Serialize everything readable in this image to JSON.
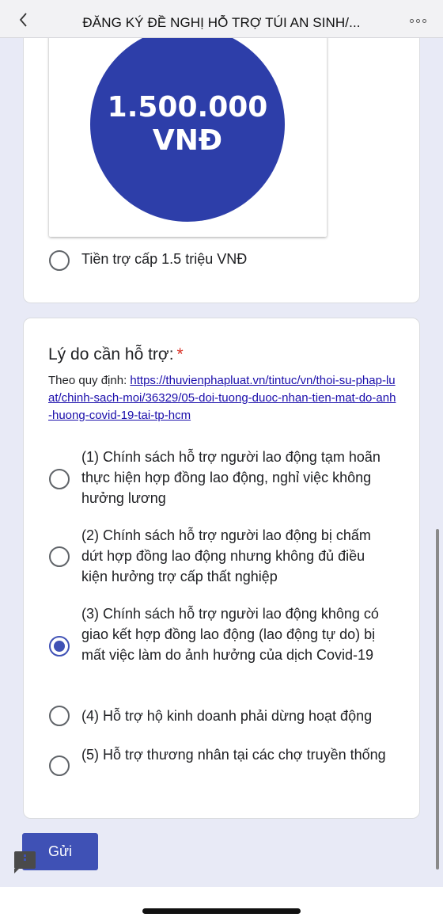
{
  "header": {
    "title": "ĐĂNG KÝ ĐỀ NGHỊ HỖ TRỢ TÚI AN SINH/...",
    "back_icon": "chevron-left-icon",
    "more_icon": "more-horizontal-icon"
  },
  "image_card": {
    "coin_amount": "1.500.000",
    "coin_currency": "VNĐ",
    "option_label": "Tiền trợ cấp 1.5 triệu VNĐ",
    "option_selected": false
  },
  "question": {
    "title": "Lý do cần hỗ trợ:",
    "required_mark": "*",
    "description_prefix": "Theo quy định: ",
    "description_link": "https://thuvienphapluat.vn/tintuc/vn/thoi-su-phap-luat/chinh-sach-moi/36329/05-doi-tuong-duoc-nhan-tien-mat-do-anh-huong-covid-19-tai-tp-hcm",
    "options": [
      {
        "label": "(1) Chính sách hỗ trợ người lao động tạm hoãn thực hiện hợp đồng lao động, nghỉ việc không hưởng lương",
        "selected": false
      },
      {
        "label": "(2) Chính sách hỗ trợ người lao động bị chấm dứt hợp đồng lao động nhưng không đủ điều kiện hưởng trợ cấp thất nghiệp",
        "selected": false
      },
      {
        "label": "(3) Chính sách hỗ trợ người lao động không có giao kết hợp đồng lao động (lao động tự do) bị mất việc làm do ảnh hưởng của dịch Covid-19",
        "selected": true
      },
      {
        "label": "(4) Hỗ trợ hộ kinh doanh phải dừng hoạt động",
        "selected": false
      },
      {
        "label": "(5) Hỗ trợ thương nhân tại các chợ truyền thống",
        "selected": false
      }
    ]
  },
  "submit": {
    "label": "Gửi"
  },
  "colors": {
    "accent": "#3f51b5",
    "coin": "#2d3ea9",
    "background": "#e8eaf6",
    "required": "#d93025"
  }
}
